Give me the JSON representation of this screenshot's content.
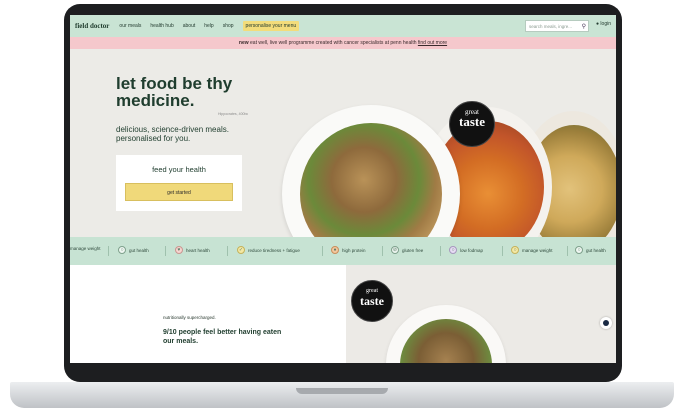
{
  "nav": {
    "logo": "field doctor",
    "links": [
      "our meals",
      "health hub",
      "about",
      "help",
      "shop",
      "personalise your menu"
    ],
    "search_placeholder": "search meals, ingre...",
    "login": "login"
  },
  "banner": {
    "new_label": "new",
    "text": " eat well, live well programme created with cancer specialists at penn health ",
    "link": "find out more"
  },
  "hero": {
    "title": "let food be thy medicine.",
    "credit": "Hippocrates, 400bc",
    "subtitle": "delicious, science-driven meals. personalised for you.",
    "cta_title": "feed your health",
    "cta_button": "get started",
    "badge_top": "great",
    "badge_bottom": "taste"
  },
  "benefits": [
    {
      "label": "manage weight",
      "icon": "scale-icon"
    },
    {
      "label": "gut health",
      "icon": "gut-icon"
    },
    {
      "label": "heart health",
      "icon": "heart-icon"
    },
    {
      "label": "reduce tiredness + fatigue",
      "icon": "bolt-icon"
    },
    {
      "label": "high protein",
      "icon": "protein-icon"
    },
    {
      "label": "gluten free",
      "icon": "gluten-free-icon"
    },
    {
      "label": "low fodmap",
      "icon": "fodmap-icon"
    },
    {
      "label": "manage weight",
      "icon": "scale-icon"
    },
    {
      "label": "gut health",
      "icon": "gut-icon"
    }
  ],
  "lower": {
    "kicker": "nutritionally supercharged.",
    "text": "9/10 people feel better having eaten our meals.",
    "badge_top": "great",
    "badge_bottom": "taste"
  }
}
